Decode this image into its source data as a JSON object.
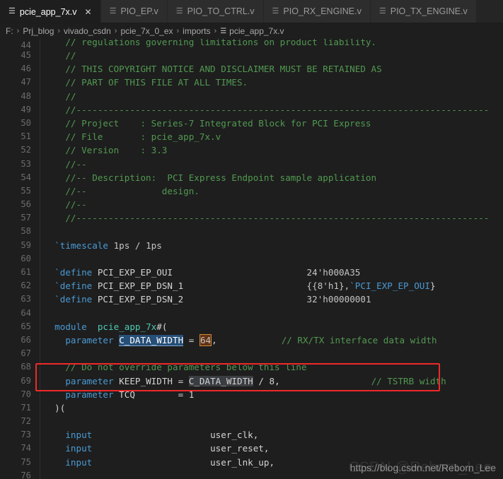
{
  "tabs": [
    {
      "label": "pcie_app_7x.v",
      "icon": "file-lines-icon",
      "active": true,
      "close": "✕"
    },
    {
      "label": "PIO_EP.v",
      "icon": "file-lines-icon",
      "active": false
    },
    {
      "label": "PIO_TO_CTRL.v",
      "icon": "file-lines-icon",
      "active": false
    },
    {
      "label": "PIO_RX_ENGINE.v",
      "icon": "file-lines-icon",
      "active": false
    },
    {
      "label": "PIO_TX_ENGINE.v",
      "icon": "file-lines-icon",
      "active": false
    }
  ],
  "breadcrumb": {
    "separator": "›",
    "file_icon": "file-lines-icon",
    "items": [
      "F:",
      "Prj_blog",
      "vivado_csdn",
      "pcie_7x_0_ex",
      "imports",
      "pcie_app_7x.v"
    ]
  },
  "editor": {
    "first_line": 44,
    "lines": [
      {
        "n": 44,
        "clipped": true,
        "tokens": [
          {
            "t": "    // regulations governing limitations on product liability.",
            "c": "cmt"
          }
        ]
      },
      {
        "n": 45,
        "tokens": [
          {
            "t": "    //",
            "c": "cmt"
          }
        ]
      },
      {
        "n": 46,
        "tokens": [
          {
            "t": "    // THIS COPYRIGHT NOTICE AND DISCLAIMER MUST BE RETAINED AS",
            "c": "cmt"
          }
        ]
      },
      {
        "n": 47,
        "tokens": [
          {
            "t": "    // PART OF THIS FILE AT ALL TIMES.",
            "c": "cmt"
          }
        ]
      },
      {
        "n": 48,
        "tokens": [
          {
            "t": "    //",
            "c": "cmt"
          }
        ]
      },
      {
        "n": 49,
        "tokens": [
          {
            "t": "    //-----------------------------------------------------------------------------",
            "c": "cmt"
          }
        ]
      },
      {
        "n": 50,
        "tokens": [
          {
            "t": "    // Project    : Series-7 Integrated Block for PCI Express",
            "c": "cmt"
          }
        ]
      },
      {
        "n": 51,
        "tokens": [
          {
            "t": "    // File       : pcie_app_7x.v",
            "c": "cmt"
          }
        ]
      },
      {
        "n": 52,
        "tokens": [
          {
            "t": "    // Version    : 3.3",
            "c": "cmt"
          }
        ]
      },
      {
        "n": 53,
        "tokens": [
          {
            "t": "    //--",
            "c": "cmt"
          }
        ]
      },
      {
        "n": 54,
        "tokens": [
          {
            "t": "    //-- Description:  PCI Express Endpoint sample application",
            "c": "cmt"
          }
        ]
      },
      {
        "n": 55,
        "tokens": [
          {
            "t": "    //--              design.",
            "c": "cmt"
          }
        ]
      },
      {
        "n": 56,
        "tokens": [
          {
            "t": "    //--",
            "c": "cmt"
          }
        ]
      },
      {
        "n": 57,
        "tokens": [
          {
            "t": "    //-----------------------------------------------------------------------------",
            "c": "cmt"
          }
        ]
      },
      {
        "n": 58,
        "tokens": []
      },
      {
        "n": 59,
        "tokens": [
          {
            "t": "  ",
            "c": "punc"
          },
          {
            "t": "`timescale",
            "c": "kw"
          },
          {
            "t": " 1ps / 1ps",
            "c": "num"
          }
        ]
      },
      {
        "n": 60,
        "tokens": []
      },
      {
        "n": 61,
        "tokens": [
          {
            "t": "  ",
            "c": "punc"
          },
          {
            "t": "`define",
            "c": "kw"
          },
          {
            "t": " PCI_EXP_EP_OUI",
            "c": "id"
          },
          {
            "t": "                         24'h000A35",
            "c": "num"
          }
        ]
      },
      {
        "n": 62,
        "tokens": [
          {
            "t": "  ",
            "c": "punc"
          },
          {
            "t": "`define",
            "c": "kw"
          },
          {
            "t": " PCI_EXP_EP_DSN_1",
            "c": "id"
          },
          {
            "t": "                       {{8'h1},",
            "c": "num"
          },
          {
            "t": "`PCI_EXP_EP_OUI",
            "c": "kw"
          },
          {
            "t": "}",
            "c": "punc"
          }
        ]
      },
      {
        "n": 63,
        "tokens": [
          {
            "t": "  ",
            "c": "punc"
          },
          {
            "t": "`define",
            "c": "kw"
          },
          {
            "t": " PCI_EXP_EP_DSN_2",
            "c": "id"
          },
          {
            "t": "                       32'h00000001",
            "c": "num"
          }
        ]
      },
      {
        "n": 64,
        "tokens": []
      },
      {
        "n": 65,
        "tokens": [
          {
            "t": "  ",
            "c": "punc"
          },
          {
            "t": "module",
            "c": "kw"
          },
          {
            "t": "  ",
            "c": "punc"
          },
          {
            "t": "pcie_app_7x",
            "c": "type"
          },
          {
            "t": "#(",
            "c": "punc"
          }
        ]
      },
      {
        "n": 66,
        "tokens": [
          {
            "t": "    ",
            "c": "punc"
          },
          {
            "t": "parameter",
            "c": "kw"
          },
          {
            "t": " ",
            "c": "punc"
          },
          {
            "t": "C_DATA_WIDTH",
            "c": "sel"
          },
          {
            "t": " = ",
            "c": "punc"
          },
          {
            "t": "64",
            "c": "findmatch"
          },
          {
            "t": ",",
            "c": "punc"
          },
          {
            "t": "            // RX/TX interface data width",
            "c": "cmt"
          }
        ]
      },
      {
        "n": 67,
        "tokens": []
      },
      {
        "n": 68,
        "tokens": [
          {
            "t": "    // Do not override parameters below this line",
            "c": "cmt"
          }
        ]
      },
      {
        "n": 69,
        "tokens": [
          {
            "t": "    ",
            "c": "punc"
          },
          {
            "t": "parameter",
            "c": "kw"
          },
          {
            "t": " KEEP_WIDTH = ",
            "c": "punc"
          },
          {
            "t": "C_DATA_WIDTH",
            "c": "occ"
          },
          {
            "t": " / 8,",
            "c": "punc"
          },
          {
            "t": "                 // TSTRB width",
            "c": "cmt"
          }
        ]
      },
      {
        "n": 70,
        "tokens": [
          {
            "t": "    ",
            "c": "punc"
          },
          {
            "t": "parameter",
            "c": "kw"
          },
          {
            "t": " TCQ        = 1",
            "c": "punc"
          }
        ]
      },
      {
        "n": 71,
        "tokens": [
          {
            "t": "  )(",
            "c": "punc"
          }
        ]
      },
      {
        "n": 72,
        "tokens": []
      },
      {
        "n": 73,
        "tokens": [
          {
            "t": "    ",
            "c": "punc"
          },
          {
            "t": "input",
            "c": "kw"
          },
          {
            "t": "                      user_clk,",
            "c": "id"
          }
        ]
      },
      {
        "n": 74,
        "tokens": [
          {
            "t": "    ",
            "c": "punc"
          },
          {
            "t": "input",
            "c": "kw"
          },
          {
            "t": "                      user_reset,",
            "c": "id"
          }
        ]
      },
      {
        "n": 75,
        "tokens": [
          {
            "t": "    ",
            "c": "punc"
          },
          {
            "t": "input",
            "c": "kw"
          },
          {
            "t": "                      user_lnk_up,",
            "c": "id"
          }
        ]
      },
      {
        "n": 76,
        "tokens": []
      }
    ]
  },
  "annotation": {
    "shape": "rectangle",
    "color": "#ef2929",
    "target_line": 66
  },
  "watermark": {
    "text": "https://blog.csdn.net/Reborn_Lee",
    "ghost": "CSDN @Reborn_Lee"
  }
}
